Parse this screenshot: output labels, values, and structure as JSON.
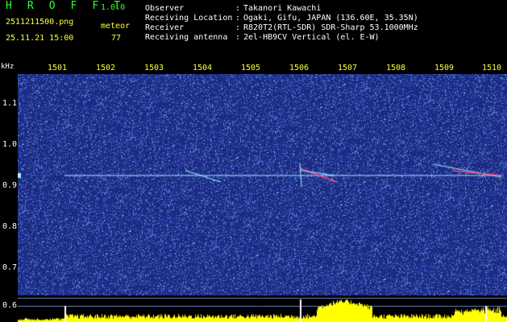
{
  "header": {
    "app_name": "H R O F F T",
    "app_version": "1.0.0",
    "filename": "2511211500.png",
    "timestamp": "25.11.21 15:00",
    "meteor_label": "meteor",
    "meteor_count": "77",
    "info": [
      {
        "label": "Observer",
        "colon": ":",
        "value": "Takanori Kawachi"
      },
      {
        "label": "Receiving Location",
        "colon": ":",
        "value": "Ogaki, Gifu, JAPAN (136.60E, 35.35N)"
      },
      {
        "label": "Receiver",
        "colon": ":",
        "value": "R820T2(RTL-SDR) SDR-Sharp 53.1000MHz"
      },
      {
        "label": "Receiving antenna",
        "colon": ":",
        "value": "2el-HB9CV Vertical (el. E-W)"
      }
    ]
  },
  "spectrogram": {
    "y_unit": "kHz",
    "x_ticks": [
      "1501",
      "1502",
      "1503",
      "1504",
      "1505",
      "1506",
      "1507",
      "1508",
      "1509",
      "1510"
    ],
    "y_ticks": [
      "1.1",
      "1.0",
      "0.9",
      "0.8",
      "0.7",
      "0.6"
    ],
    "colors": {
      "background": "#1a2a7a",
      "noise_low": "#2a3f9e",
      "noise_high": "#7a8cff",
      "carrier": "#9ff0ff",
      "echo": "#ff4a8a",
      "level": "#ffff00",
      "tick_text": "#ffff33"
    }
  }
}
